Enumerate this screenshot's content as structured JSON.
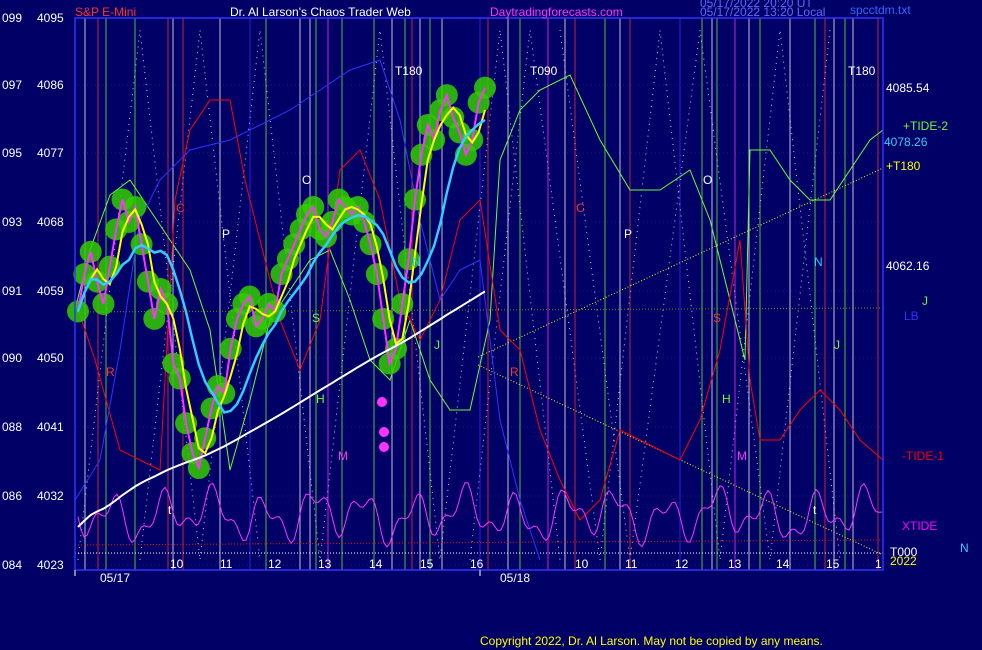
{
  "header": {
    "symbol": "S&P E-Mini",
    "title": "Dr. Al Larson's Chaos Trader Web",
    "site": "Daytradingforecasts.com",
    "stamp1": "05/17/2022 20:20 UT",
    "stamp2": "05/17/2022 13:20 Local",
    "file": "spcctdm.txt"
  },
  "copyright": "Copyright 2022, Dr. Al Larson. May not be copied by any means.",
  "colors": {
    "background": "#000066",
    "plot_border": "#3333ff",
    "price_bars": "#ff00ff",
    "ma_yellow": "#ffff00",
    "ma_cyan": "#33ccff",
    "ma_white": "#ffffff",
    "tide_green": "#66ff33",
    "tide_red": "#ff0000",
    "xtide_magenta": "#ff00ff",
    "bubble_green": "#33cc00"
  },
  "chart_data": {
    "type": "line",
    "title": "S&P E-Mini",
    "y_left_labels": [
      "099",
      "097",
      "095",
      "093",
      "091",
      "090",
      "088",
      "086",
      "084"
    ],
    "y_right_labels": [
      "4095",
      "4086",
      "4077",
      "4068",
      "4059",
      "4050",
      "4041",
      "4032",
      "4023"
    ],
    "x_labels": [
      "05/17",
      "10",
      "11",
      "12",
      "13",
      "14",
      "15",
      "16",
      "05/18",
      "10",
      "11",
      "12",
      "13",
      "14",
      "15",
      "1"
    ],
    "right_price_labels": [
      "4085.54",
      "4078.26",
      "4062.16"
    ],
    "ylim": [
      4023,
      4095
    ],
    "cycle_labels": [
      "T180",
      "T090",
      "T180"
    ],
    "series": [
      {
        "name": "+TIDE-2",
        "color": "#66ff33"
      },
      {
        "name": "+T180",
        "color": "#ffff00"
      },
      {
        "name": "-TIDE-1",
        "color": "#ff0000"
      },
      {
        "name": "XTIDE",
        "color": "#ff00ff"
      },
      {
        "name": "T000",
        "color": "#ffffff"
      },
      {
        "name": "2022",
        "color": "#ffff00"
      },
      {
        "name": "LB",
        "color": "#3333ff"
      },
      {
        "name": "J",
        "color": "#66ff33"
      },
      {
        "name": "N",
        "color": "#33ccff"
      }
    ],
    "markers": [
      "O",
      "P",
      "C",
      "S",
      "N",
      "R",
      "H",
      "M",
      "J",
      "t",
      "O",
      "P",
      "C",
      "S",
      "N",
      "R",
      "H",
      "M",
      "J",
      "t"
    ],
    "price_path": [
      4057,
      4062,
      4065,
      4061,
      4058,
      4063,
      4068,
      4072,
      4069,
      4071,
      4066,
      4061,
      4056,
      4060,
      4058,
      4050,
      4048,
      4042,
      4038,
      4036,
      4040,
      4044,
      4047,
      4046,
      4052,
      4056,
      4058,
      4059,
      4055,
      4056,
      4058,
      4057,
      4062,
      4064,
      4066,
      4068,
      4070,
      4071,
      4068,
      4067,
      4069,
      4072,
      4071,
      4070,
      4071,
      4069,
      4066,
      4062,
      4056,
      4050,
      4052,
      4058,
      4064,
      4072,
      4078,
      4082,
      4080,
      4084,
      4086,
      4083,
      4081,
      4078,
      4080,
      4085,
      4087
    ]
  }
}
